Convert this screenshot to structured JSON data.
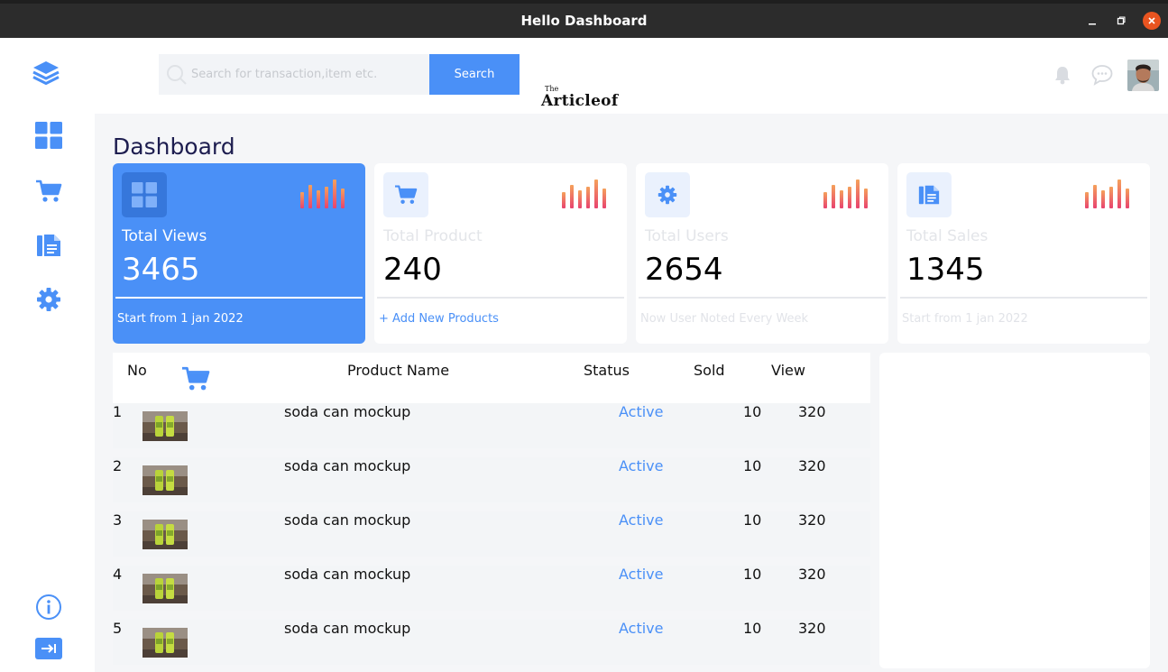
{
  "window": {
    "title": "Hello Dashboard"
  },
  "search": {
    "placeholder": "Search for transaction,item etc.",
    "button_label": "Search"
  },
  "brand": {
    "prefix": "The",
    "name": "Articleof"
  },
  "page": {
    "title": "Dashboard"
  },
  "cards": [
    {
      "label": "Total Views",
      "value": "3465",
      "footer": "Start from 1 jan 2022",
      "icon": "grid-icon"
    },
    {
      "label": "Total Product",
      "value": "240",
      "footer": "+ Add New Products",
      "icon": "cart-icon"
    },
    {
      "label": "Total Users",
      "value": "2654",
      "footer": "Now User Noted Every Week",
      "icon": "gear-icon"
    },
    {
      "label": "Total Sales",
      "value": "1345",
      "footer": "Start from 1 jan 2022",
      "icon": "document-icon"
    }
  ],
  "table": {
    "headers": {
      "no": "No",
      "name": "Product Name",
      "status": "Status",
      "sold": "Sold",
      "view": "View"
    },
    "rows": [
      {
        "no": "1",
        "name": "soda can mockup",
        "status": "Active",
        "sold": "10",
        "view": "320"
      },
      {
        "no": "2",
        "name": "soda can mockup",
        "status": "Active",
        "sold": "10",
        "view": "320"
      },
      {
        "no": "3",
        "name": "soda can mockup",
        "status": "Active",
        "sold": "10",
        "view": "320"
      },
      {
        "no": "4",
        "name": "soda can mockup",
        "status": "Active",
        "sold": "10",
        "view": "320"
      },
      {
        "no": "5",
        "name": "soda can mockup",
        "status": "Active",
        "sold": "10",
        "view": "320"
      }
    ]
  },
  "sidebar": {
    "items": [
      "dashboard-grid-icon",
      "cart-icon",
      "document-icon",
      "settings-gear-icon",
      "info-icon",
      "logout-icon"
    ]
  },
  "colors": {
    "accent": "#4a90f7",
    "title_bar": "#2c2c2c",
    "close": "#e95420",
    "chart_top": "#f5a15b",
    "chart_bottom": "#e8436f"
  }
}
